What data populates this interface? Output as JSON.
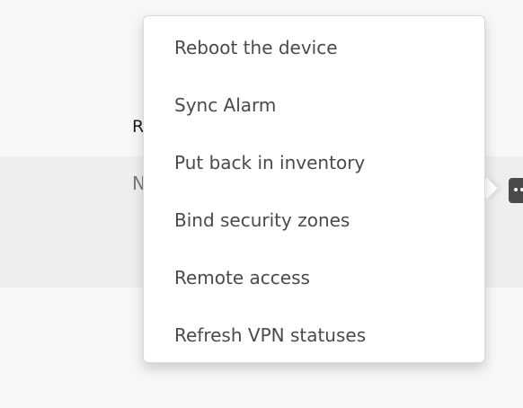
{
  "background": {
    "row_header_letter": "R",
    "row_cell_letter": "N"
  },
  "actions_button": {
    "icon": "more-horizontal-icon"
  },
  "menu": {
    "items": [
      {
        "label": "Reboot the device"
      },
      {
        "label": "Sync Alarm"
      },
      {
        "label": "Put back in inventory"
      },
      {
        "label": "Bind security zones"
      },
      {
        "label": "Remote access"
      },
      {
        "label": "Refresh VPN statuses"
      }
    ]
  },
  "colors": {
    "page_background": "#f8f7f6",
    "row_highlight": "#efeeec",
    "menu_background": "#ffffff",
    "menu_text": "#4a4a4a",
    "actions_button": "#4a4a4a"
  }
}
